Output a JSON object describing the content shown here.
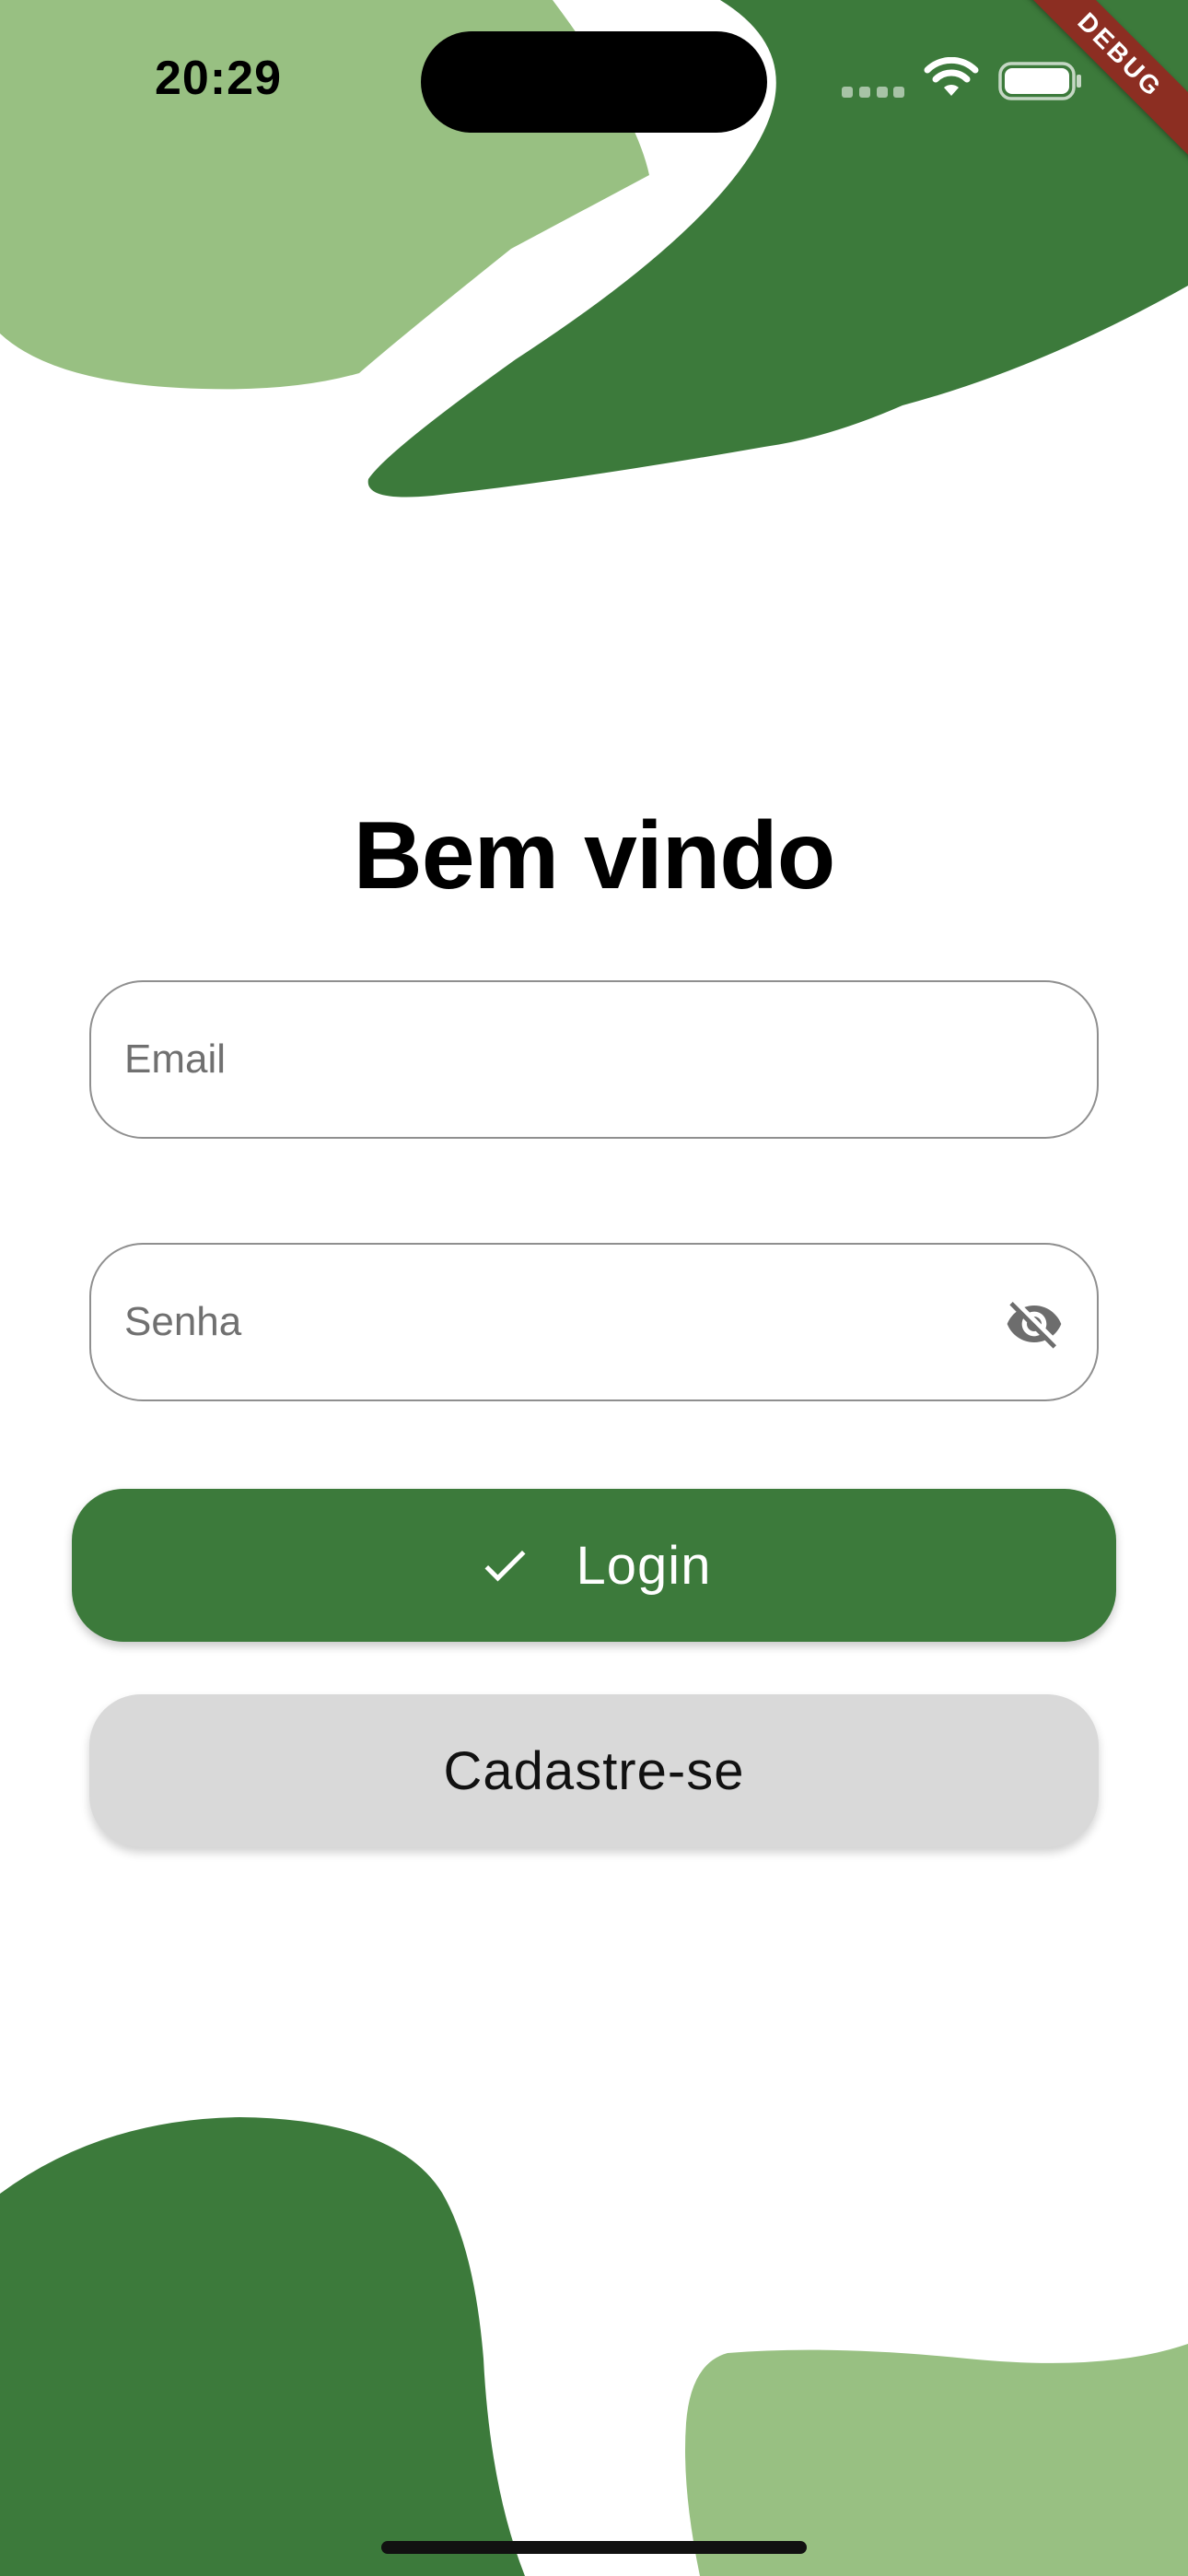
{
  "colors": {
    "dark_green": "#3c7a3b",
    "light_green": "#98c082",
    "button_gray": "#d9d9d9",
    "debug_red": "#8c2e22"
  },
  "status_bar": {
    "time": "20:29",
    "icons": [
      "signal-icon",
      "wifi-icon",
      "battery-icon"
    ]
  },
  "debug_banner": "DEBUG",
  "title": "Bem vindo",
  "email": {
    "placeholder": "Email",
    "value": ""
  },
  "password": {
    "placeholder": "Senha",
    "value": "",
    "toggle_icon": "visibility-off-icon"
  },
  "login_button": {
    "label": "Login",
    "icon": "check-icon"
  },
  "register_button": {
    "label": "Cadastre-se"
  }
}
